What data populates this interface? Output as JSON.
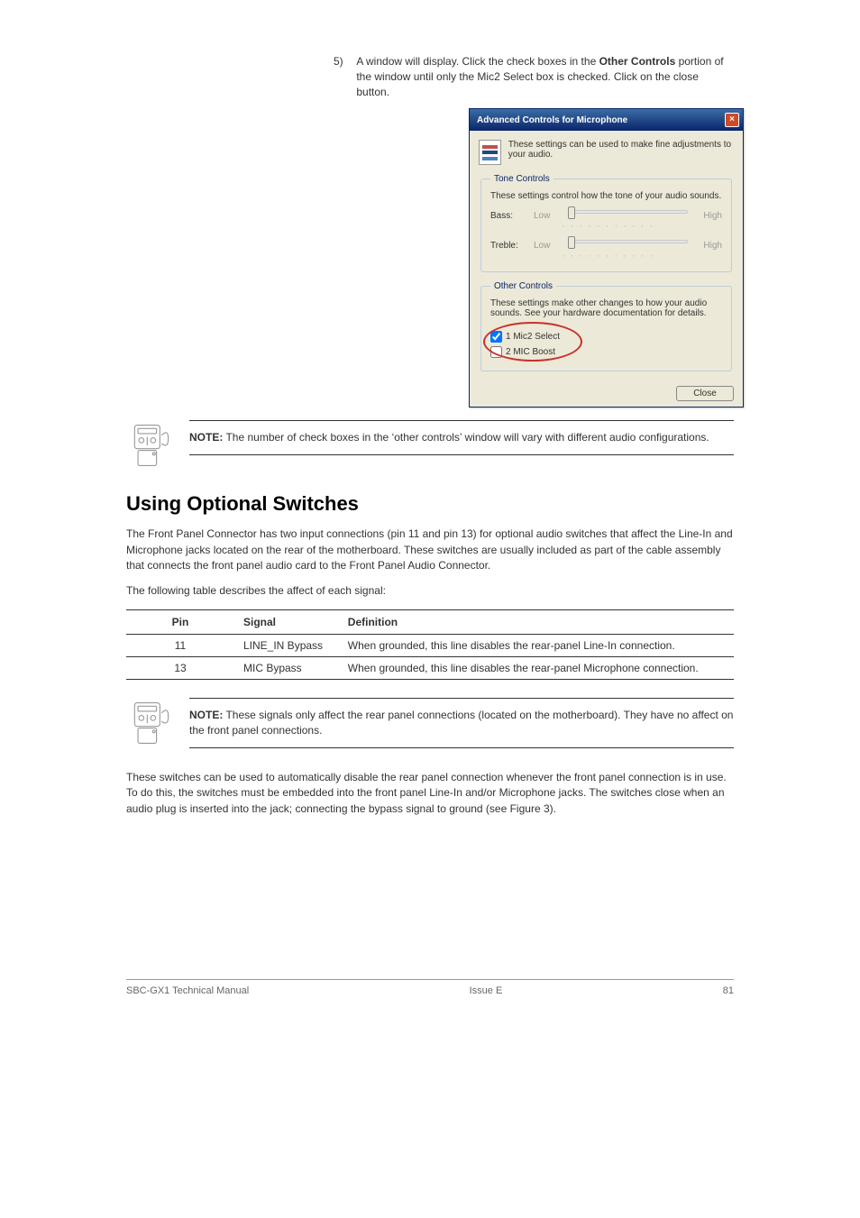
{
  "step5": {
    "num": "5)",
    "text_a": "A window will display. Click the check boxes in the ",
    "bold": "Other Controls",
    "text_b": " portion of the window until only the Mic2 Select box is checked. Click on the close button."
  },
  "dialog": {
    "title": "Advanced Controls for Microphone",
    "close_glyph": "×",
    "intro": "These settings can be used to make fine adjustments to your audio.",
    "tone": {
      "legend": "Tone Controls",
      "desc": "These settings control how the tone of your audio sounds.",
      "bass_label": "Bass:",
      "treble_label": "Treble:",
      "low": "Low",
      "high": "High"
    },
    "other": {
      "legend": "Other Controls",
      "desc": "These settings make other changes to how your audio sounds. See your hardware documentation for details.",
      "cb1": "1  Mic2 Select",
      "cb2": "2  MIC Boost"
    },
    "close_button": "Close"
  },
  "note1": {
    "label": "NOTE:",
    "text": " The number of check boxes in the ‘other controls’ window will vary with different audio configurations."
  },
  "heading": "Using Optional Switches",
  "para1": "The Front Panel Connector has two input connections (pin 11 and pin 13) for optional audio switches that affect the Line-In and Microphone jacks located on the rear of the motherboard. These switches are usually included as part of the cable assembly that connects the front panel audio card to the Front Panel Audio Connector.",
  "para2": "The following table describes the affect of each signal:",
  "table": {
    "h_pin": "Pin",
    "h_sig": "Signal",
    "h_def": "Definition",
    "rows": [
      {
        "pin": "11",
        "sig": "LINE_IN Bypass",
        "def": "When grounded, this line disables the rear-panel Line-In connection."
      },
      {
        "pin": "13",
        "sig": "MIC Bypass",
        "def": "When grounded, this line disables the rear-panel Microphone connection."
      }
    ]
  },
  "note2": {
    "label": "NOTE:",
    "text": " These signals only affect the rear panel connections (located on the motherboard). They have no affect on the front panel connections."
  },
  "para3": "These switches can be used to automatically disable the rear panel connection whenever the front panel connection is in use. To do this, the switches must be embedded into the front panel Line-In and/or Microphone jacks. The switches close when an audio plug is inserted into the jack; connecting the bypass signal to ground (see Figure 3).",
  "footer": {
    "manual": "SBC-GX1 Technical Manual",
    "issue": "Issue E",
    "page": "81"
  }
}
